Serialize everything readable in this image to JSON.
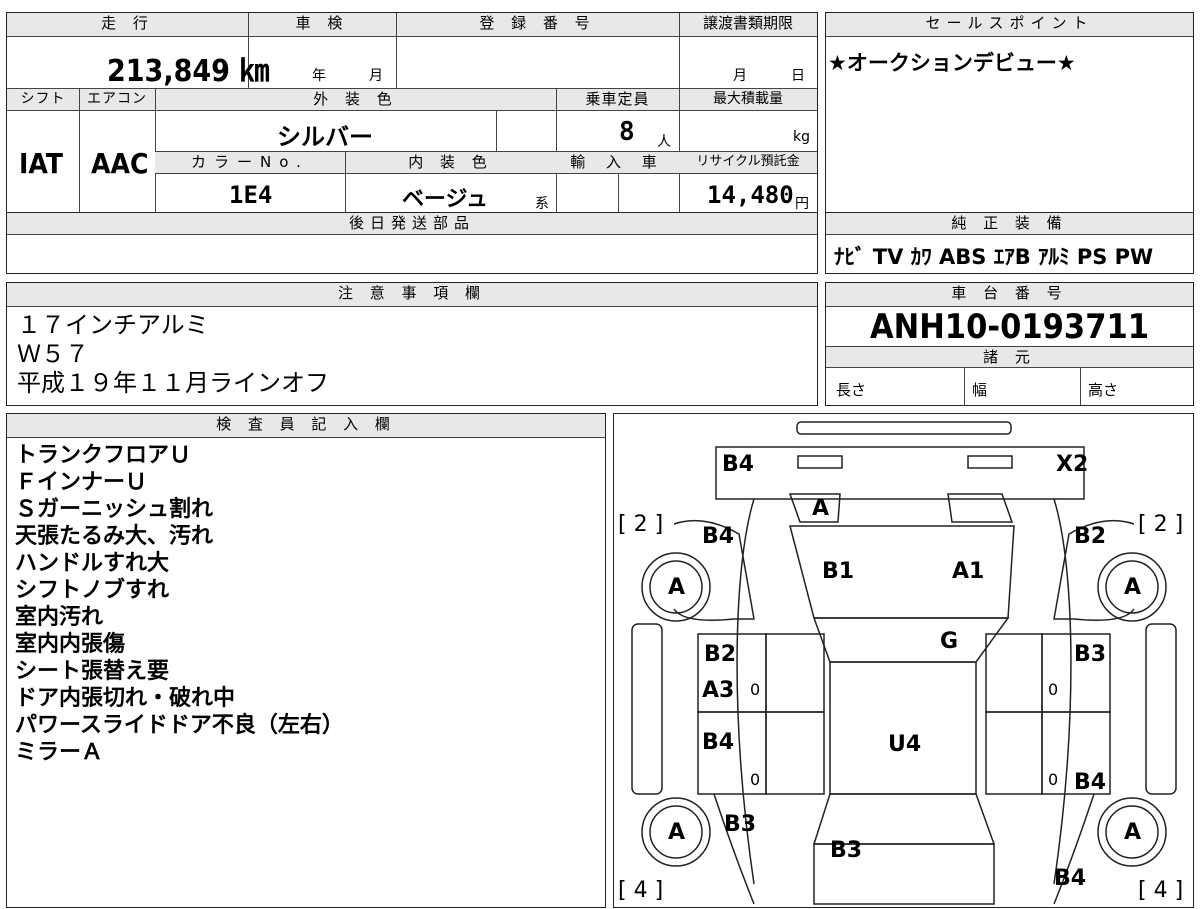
{
  "top": {
    "mileage_header": "走 行",
    "mileage_value": "213,849 ㎞",
    "inspection_header": "車 検",
    "inspection_year": "年",
    "inspection_month": "月",
    "registration_header": "登 録 番 号",
    "transfer_header": "譲渡書類期限",
    "transfer_month": "月",
    "transfer_day": "日",
    "salespoint_header": "セールスポイント",
    "salespoint_value": "★オークションデビュー★"
  },
  "specs": {
    "shift_header": "シフト",
    "shift_value": "IAT",
    "aircon_header": "エアコン",
    "aircon_value": "AAC",
    "exterior_header": "外 装 色",
    "exterior_value": "シルバー",
    "capacity_header": "乗車定員",
    "capacity_value": "8",
    "capacity_unit": "人",
    "load_header": "最大積載量",
    "load_unit": "kg",
    "color_no_header": "カラーNo.",
    "color_no_value": "1E4",
    "interior_header": "内 装 色",
    "interior_value": "ベージュ",
    "interior_suffix": "系",
    "import_header": "輸 入 車",
    "recycle_header": "リサイクル預託金",
    "recycle_value": "14,480",
    "recycle_unit": "円",
    "shipping_header": "後日発送部品",
    "equipment_header": "純 正 装 備",
    "equipment_value": "ﾅﾋﾞ TV ｶﾜ ABS ｴｱB ｱﾙﾐ PS PW"
  },
  "notes": {
    "header": "注 意 事 項 欄",
    "lines": [
      "１７インチアルミ",
      "Ｗ５７",
      "平成１９年１１月ラインオフ"
    ]
  },
  "chassis": {
    "header": "車 台 番 号",
    "value": "ANH10-0193711",
    "dims_header": "諸 元",
    "length": "長さ",
    "width": "幅",
    "height": "高さ"
  },
  "inspector": {
    "header": "検 査 員 記 入 欄",
    "lines": [
      "トランクフロアＵ",
      "ＦインナーＵ",
      "Ｓガーニッシュ割れ",
      "天張たるみ大、汚れ",
      "ハンドルすれ大",
      "シフトノブすれ",
      "室内汚れ",
      "室内内張傷",
      "シート張替え要",
      "ドア内張切れ・破れ中",
      "パワースライドドア不良（左右）",
      "ミラーＡ"
    ]
  },
  "diagram": {
    "labels": {
      "rear_left": "B4",
      "rear_right": "X2",
      "trunk": "A",
      "left_rear_qtr": "B4",
      "right_rear_qtr": "B2",
      "roof_left": "B1",
      "roof_right": "A1",
      "tire_rl": "A",
      "tire_rr": "A",
      "tire_fl": "A",
      "tire_fr": "A",
      "glass": "G",
      "left_door_upper": "B2",
      "left_door_a3": "A3",
      "right_door_upper": "B3",
      "left_door_lower": "B4",
      "interior": "U4",
      "right_door_lower": "B4",
      "left_front": "B3",
      "hood": "B3",
      "right_front": "B4",
      "tire_count_rear_left": "[ 2 ]",
      "tire_count_rear_right": "[ 2 ]",
      "tire_count_front_left": "[ 4 ]",
      "tire_count_front_right": "[ 4 ]",
      "zero_a": "0",
      "zero_b": "0",
      "zero_c": "0",
      "zero_d": "0"
    }
  }
}
